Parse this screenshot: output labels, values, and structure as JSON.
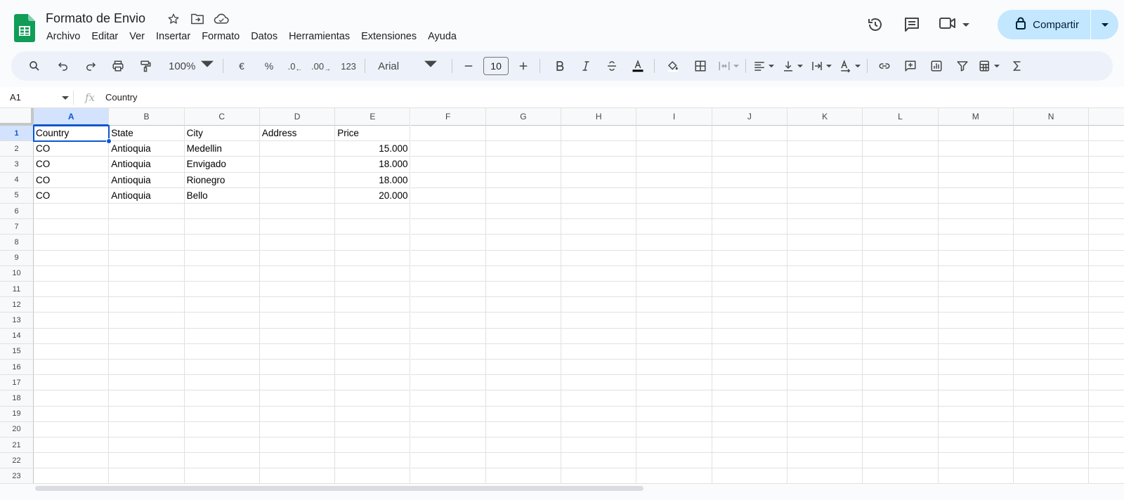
{
  "document": {
    "title": "Formato de Envio"
  },
  "menu": [
    "Archivo",
    "Editar",
    "Ver",
    "Insertar",
    "Formato",
    "Datos",
    "Herramientas",
    "Extensiones",
    "Ayuda"
  ],
  "actions": {
    "share_label": "Compartir"
  },
  "toolbar": {
    "zoom": "100%",
    "currency": "€",
    "percent": "%",
    "dec_decrease": ".0",
    "dec_increase": ".00",
    "number_format": "123",
    "font": "Arial",
    "font_size": "10"
  },
  "formula_bar": {
    "cell_ref": "A1",
    "content": "Country"
  },
  "columns": [
    "A",
    "B",
    "C",
    "D",
    "E",
    "F",
    "G",
    "H",
    "I",
    "J",
    "K",
    "L",
    "M",
    "N"
  ],
  "rows": [
    "1",
    "2",
    "3",
    "4",
    "5",
    "6",
    "7",
    "8",
    "9",
    "10",
    "11",
    "12",
    "13",
    "14",
    "15",
    "16",
    "17",
    "18",
    "19",
    "20",
    "21",
    "22",
    "23"
  ],
  "cells": [
    [
      "Country",
      "State",
      "City",
      "Address",
      "Price"
    ],
    [
      "CO",
      "Antioquia",
      "Medellin",
      "",
      "15.000"
    ],
    [
      "CO",
      "Antioquia",
      "Envigado",
      "",
      "18.000"
    ],
    [
      "CO",
      "Antioquia",
      "Rionegro",
      "",
      "18.000"
    ],
    [
      "CO",
      "Antioquia",
      "Bello",
      "",
      "20.000"
    ]
  ],
  "selected_cell": "A1",
  "colors": {
    "accent": "#0b57d0",
    "share_bg": "#c2e7ff",
    "sheets_green": "#0f9d58"
  }
}
